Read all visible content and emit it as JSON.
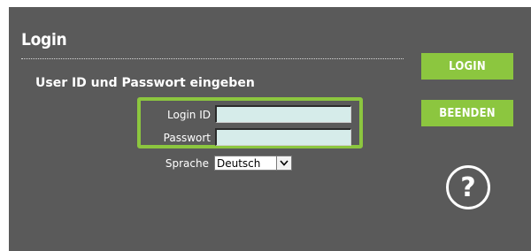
{
  "login": {
    "title": "Login",
    "subtitle": "User ID und Passwort eingeben",
    "login_id_label": "Login ID",
    "login_id_value": "",
    "password_label": "Passwort",
    "password_value": "",
    "language_label": "Sprache",
    "language_selected": "Deutsch"
  },
  "actions": {
    "login_button": "LOGIN",
    "quit_button": "BEENDEN",
    "help_glyph": "?"
  },
  "icons": {
    "dropdown": "chevron-down-icon",
    "help": "help-icon"
  },
  "colors": {
    "panel_bg": "#5a5a5a",
    "accent_green": "#8cc63f",
    "input_bg": "#d6ecea"
  }
}
